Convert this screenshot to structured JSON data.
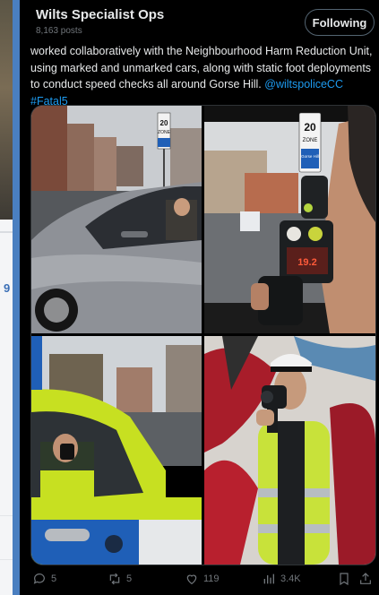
{
  "background": {
    "row_number": "9"
  },
  "tweet": {
    "account_name": "Wilts Specialist Ops",
    "post_count": "8,163 posts",
    "follow_label": "Following",
    "text_main": "worked collaboratively with the Neighbourhood Harm Reduction Unit, using marked and unmarked cars, along with static foot deployments to conduct speed checks all around Gorse Hill.",
    "mention": "@wiltspoliceCC",
    "hashtag": "#Fatal5",
    "images": [
      {
        "name": "unmarked-car-image",
        "sign_number": "20",
        "sign_zone": "ZONE"
      },
      {
        "name": "speed-gun-in-car-image",
        "sign_number": "20",
        "sign_zone": "ZONE",
        "sign_place": "Gorse Hill",
        "gun_reading": "19.2"
      },
      {
        "name": "police-car-officer-image"
      },
      {
        "name": "foot-officer-image"
      }
    ],
    "actions": {
      "replies": "5",
      "reposts": "5",
      "likes": "119",
      "views": "3.4K"
    }
  },
  "colors": {
    "card_bg": "#000000",
    "frame": "#4a7fc0",
    "text": "#e7e9ea",
    "muted": "#71767b",
    "link": "#1d9bf0",
    "police_yellow": "#c7e021",
    "police_blue": "#1f5fb7"
  }
}
